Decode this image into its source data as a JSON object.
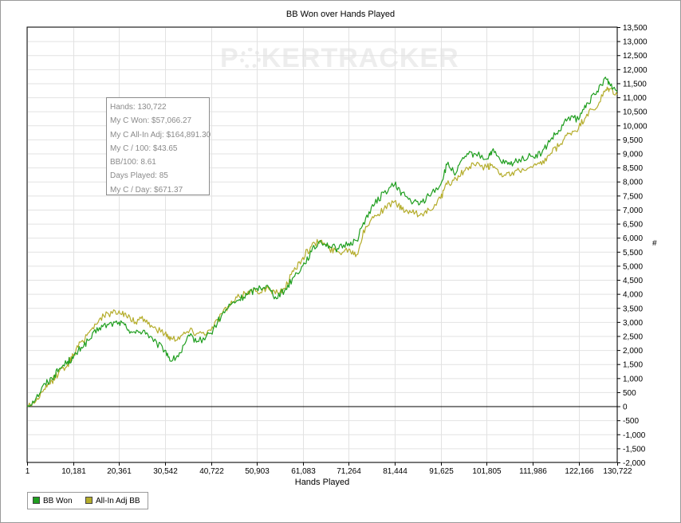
{
  "watermark": {
    "left": "P",
    "right": "KERTRACKER"
  },
  "tooltip": {
    "lines": [
      "Hands: 130,722",
      "My C Won: $57,066.27",
      "My C All-In Adj: $164,891.30",
      "My C / 100: $43.65",
      "BB/100: 8.61",
      "Days Played: 85",
      "My C / Day: $671.37"
    ]
  },
  "chart_data": {
    "type": "line",
    "title": "BB Won over Hands Played",
    "xlabel": "Hands Played",
    "ylabel": "#",
    "xlim": [
      1,
      130722
    ],
    "ylim": [
      -2000,
      13500
    ],
    "x_ticks": [
      1,
      10181,
      20361,
      30542,
      40722,
      50903,
      61083,
      71264,
      81444,
      91625,
      101805,
      111986,
      122166,
      130722
    ],
    "x_tick_labels": [
      "1",
      "10,181",
      "20,361",
      "30,542",
      "40,722",
      "50,903",
      "61,083",
      "71,264",
      "81,444",
      "91,625",
      "101,805",
      "111,986",
      "122,166",
      "130,722"
    ],
    "y_ticks": [
      -2000,
      -1500,
      -1000,
      -500,
      0,
      500,
      1000,
      1500,
      2000,
      2500,
      3000,
      3500,
      4000,
      4500,
      5000,
      5500,
      6000,
      6500,
      7000,
      7500,
      8000,
      8500,
      9000,
      9500,
      10000,
      10500,
      11000,
      11500,
      12000,
      12500,
      13000,
      13500
    ],
    "y_tick_labels": [
      "-2,000",
      "-1,500",
      "-1,000",
      "-500",
      "0",
      "500",
      "1,000",
      "1,500",
      "2,000",
      "2,500",
      "3,000",
      "3,500",
      "4,000",
      "4,500",
      "5,000",
      "5,500",
      "6,000",
      "6,500",
      "7,000",
      "7,500",
      "8,000",
      "8,500",
      "9,000",
      "9,500",
      "10,000",
      "10,500",
      "11,000",
      "11,500",
      "12,000",
      "12,500",
      "13,000",
      "13,500"
    ],
    "grid": true,
    "legend_position": "bottom-left",
    "x": [
      1,
      2000,
      4000,
      5500,
      7000,
      9000,
      10181,
      12000,
      14000,
      16000,
      18000,
      20361,
      22000,
      24000,
      26000,
      28000,
      30542,
      32000,
      34000,
      36000,
      38000,
      40722,
      43000,
      45000,
      47000,
      49000,
      50903,
      53000,
      55000,
      57000,
      59000,
      61083,
      63000,
      65000,
      67000,
      69000,
      71264,
      73000,
      75000,
      77000,
      79000,
      81444,
      83000,
      85000,
      87000,
      89000,
      91625,
      93000,
      95000,
      97000,
      99000,
      101805,
      103000,
      105000,
      107000,
      109000,
      111986,
      114000,
      116000,
      118000,
      120000,
      122166,
      124000,
      126000,
      128000,
      129000,
      130722
    ],
    "series": [
      {
        "name": "BB Won",
        "color": "#1f9e1f",
        "values": [
          0,
          300,
          800,
          1000,
          1300,
          1600,
          1700,
          2100,
          2400,
          2800,
          2900,
          3000,
          2800,
          2600,
          2700,
          2300,
          2000,
          1600,
          1900,
          2500,
          2300,
          2600,
          3200,
          3600,
          3800,
          4000,
          4200,
          4300,
          3900,
          4100,
          4600,
          5000,
          5500,
          5900,
          5700,
          5600,
          5800,
          5900,
          6700,
          7200,
          7600,
          7900,
          7600,
          7300,
          7200,
          7500,
          7900,
          8600,
          8300,
          8900,
          9000,
          8800,
          9100,
          8700,
          8600,
          8800,
          8900,
          9000,
          9500,
          9800,
          10300,
          10200,
          10800,
          11100,
          11700,
          11500,
          11200
        ]
      },
      {
        "name": "All-In Adj BB",
        "color": "#b5ad2c",
        "values": [
          0,
          200,
          600,
          900,
          1200,
          1500,
          1800,
          2300,
          2700,
          3100,
          3300,
          3400,
          3200,
          3000,
          3100,
          2800,
          2600,
          2400,
          2500,
          2700,
          2600,
          2700,
          3300,
          3600,
          3900,
          4100,
          4100,
          4200,
          4000,
          4200,
          4800,
          5300,
          5700,
          5900,
          5600,
          5500,
          5600,
          5400,
          6400,
          6800,
          7000,
          7300,
          7000,
          6900,
          6800,
          7000,
          7400,
          7900,
          8100,
          8400,
          8600,
          8500,
          8600,
          8300,
          8200,
          8400,
          8500,
          8600,
          9000,
          9300,
          9700,
          9900,
          10400,
          10600,
          11200,
          11300,
          11100
        ]
      }
    ]
  }
}
